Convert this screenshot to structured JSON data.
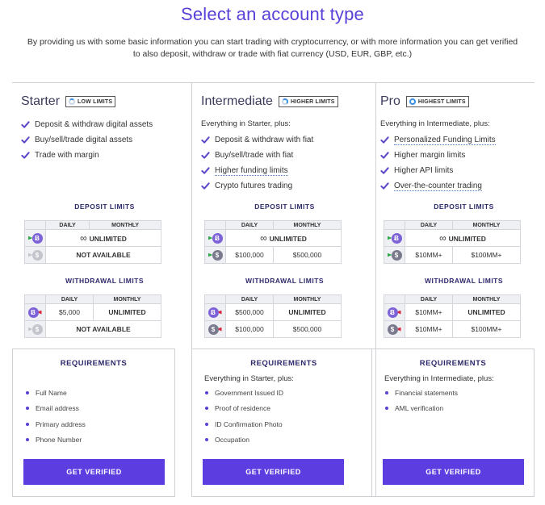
{
  "header": {
    "title": "Select an account type",
    "subtitle": "By providing us with some basic information you can start trading with cryptocurrency, or with more information you can get verified to also deposit, withdraw or trade with fiat currency (USD, EUR, GBP, etc.)"
  },
  "colors": {
    "accent": "#5841d8",
    "button": "#5b3de0",
    "check": "#5a48c8",
    "deposit_arrow": "#2fa84a",
    "withdraw_arrow": "#d7283f"
  },
  "labels": {
    "deposit_limits": "DEPOSIT LIMITS",
    "withdrawal_limits": "WITHDRAWAL LIMITS",
    "daily": "DAILY",
    "monthly": "MONTHLY",
    "requirements": "REQUIREMENTS",
    "get_verified": "GET VERIFIED",
    "unlimited": "UNLIMITED",
    "not_available": "NOT AVAILABLE",
    "infinity": "∞",
    "crypto_symbol": "Ƀ",
    "fiat_symbol": "$"
  },
  "plans": [
    {
      "name": "Starter",
      "badge": "LOW LIMITS",
      "plus": "",
      "features": [
        "Deposit & withdraw digital assets",
        "Buy/sell/trade digital assets",
        "Trade with margin"
      ],
      "deposit": {
        "crypto_monthly": "UNLIMITED",
        "fiat": "NOT AVAILABLE"
      },
      "withdrawal": {
        "crypto_daily": "$5,000",
        "crypto_monthly": "UNLIMITED",
        "fiat": "NOT AVAILABLE"
      },
      "req_plus": "",
      "requirements": [
        "Full Name",
        "Email address",
        "Primary address",
        "Phone Number"
      ]
    },
    {
      "name": "Intermediate",
      "badge": "HIGHER LIMITS",
      "plus": "Everything in Starter, plus:",
      "features": [
        "Deposit & withdraw with fiat",
        "Buy/sell/trade with fiat",
        "Higher funding limits",
        "Crypto futures trading"
      ],
      "deposit": {
        "crypto_monthly": "UNLIMITED",
        "fiat_daily": "$100,000",
        "fiat_monthly": "$500,000"
      },
      "withdrawal": {
        "crypto_daily": "$500,000",
        "crypto_monthly": "UNLIMITED",
        "fiat_daily": "$100,000",
        "fiat_monthly": "$500,000"
      },
      "req_plus": "Everything in Starter, plus:",
      "requirements": [
        "Government Issued ID",
        "Proof of residence",
        "ID Confirmation Photo",
        "Occupation"
      ]
    },
    {
      "name": "Pro",
      "badge": "HIGHEST LIMITS",
      "plus": "Everything in Intermediate, plus:",
      "features": [
        "Personalized Funding Limits",
        "Higher margin limits",
        "Higher API limits",
        "Over-the-counter trading"
      ],
      "deposit": {
        "crypto_monthly": "UNLIMITED",
        "fiat_daily": "$10MM+",
        "fiat_monthly": "$100MM+"
      },
      "withdrawal": {
        "crypto_daily": "$10MM+",
        "crypto_monthly": "UNLIMITED",
        "fiat_daily": "$10MM+",
        "fiat_monthly": "$100MM+"
      },
      "req_plus": "Everything in Intermediate, plus:",
      "requirements": [
        "Financial statements",
        "AML verification"
      ]
    }
  ]
}
